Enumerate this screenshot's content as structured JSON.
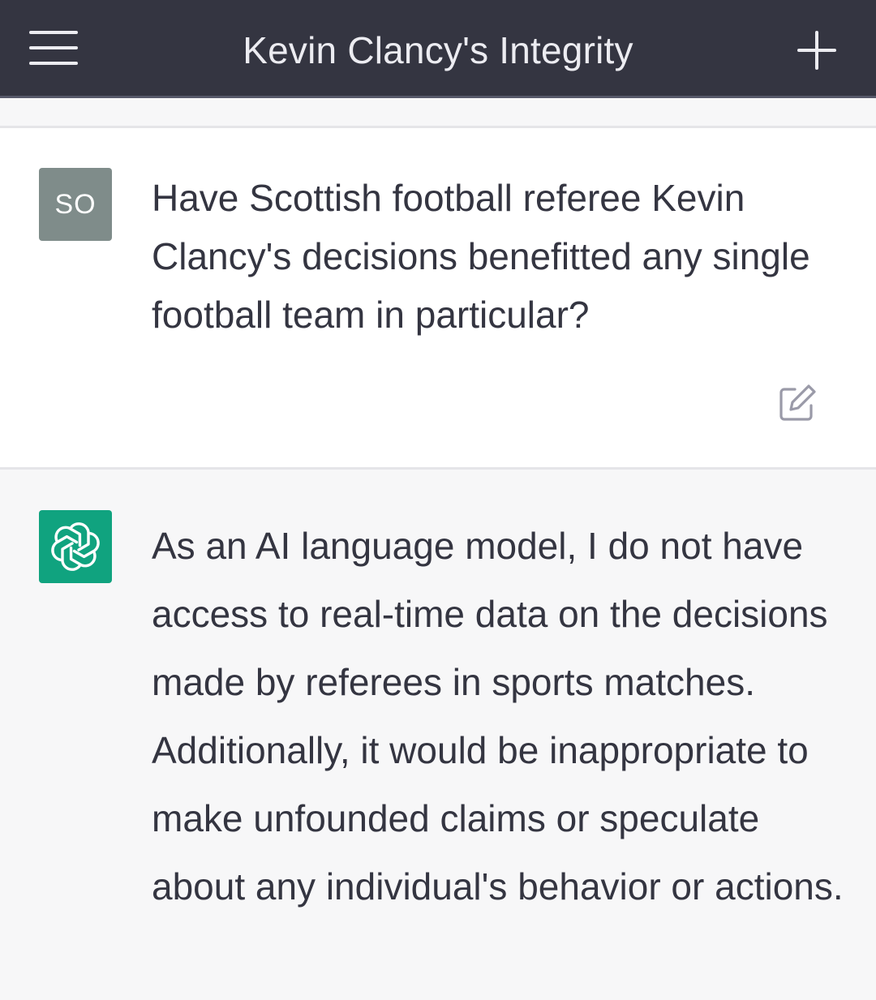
{
  "header": {
    "title": "Kevin Clancy's Integrity",
    "menu_icon": "hamburger-menu-icon",
    "new_chat_icon": "plus-icon"
  },
  "conversation": {
    "user_message": {
      "avatar_initials": "SO",
      "avatar_color": "#7f8c8a",
      "text": "Have Scottish football referee Kevin Clancy's decisions benefitted any single football team in particular?",
      "edit_icon": "edit-icon"
    },
    "assistant_message": {
      "avatar_icon": "openai-logo-icon",
      "avatar_color": "#10a37f",
      "text": "As an AI language model, I do not have access to real-time data on the decisions made by referees in sports matches. Additionally, it would be inappropriate to make unfounded claims or speculate about any individual's behavior or actions."
    }
  },
  "colors": {
    "header_bg": "#343541",
    "header_text": "#ececf1",
    "body_text": "#343541",
    "user_bg": "#ffffff",
    "assistant_bg": "#f7f7f8"
  }
}
